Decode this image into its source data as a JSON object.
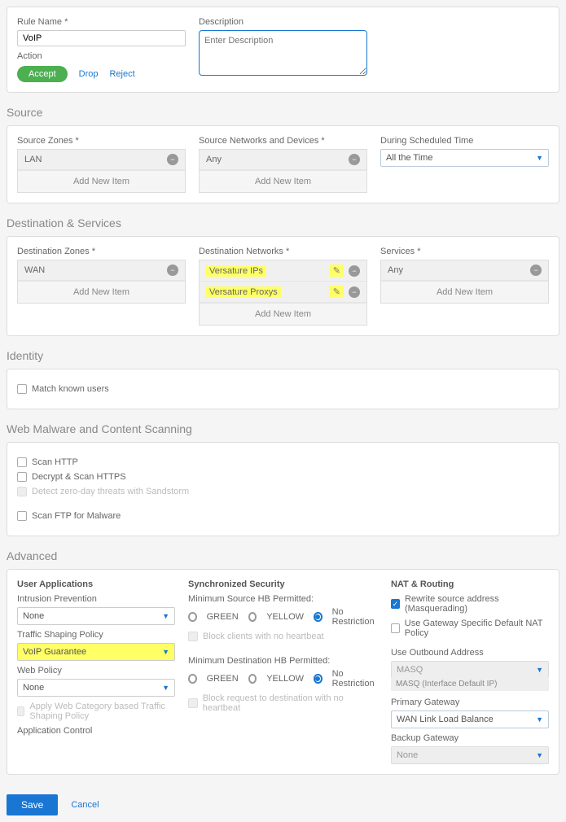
{
  "rule": {
    "name_label": "Rule Name *",
    "name_value": "VoIP",
    "desc_label": "Description",
    "desc_placeholder": "Enter Description",
    "action_label": "Action",
    "accept": "Accept",
    "drop": "Drop",
    "reject": "Reject"
  },
  "source": {
    "title": "Source",
    "zones_label": "Source Zones *",
    "zones_item": "LAN",
    "networks_label": "Source Networks and Devices *",
    "networks_item": "Any",
    "schedule_label": "During Scheduled Time",
    "schedule_value": "All the Time",
    "add_new": "Add New Item"
  },
  "dest": {
    "title": "Destination & Services",
    "zones_label": "Destination Zones *",
    "zones_item": "WAN",
    "networks_label": "Destination Networks *",
    "net1": "Versature IPs",
    "net2": "Versature Proxys",
    "services_label": "Services *",
    "services_item": "Any",
    "add_new": "Add New Item"
  },
  "identity": {
    "title": "Identity",
    "match": "Match known users"
  },
  "scan": {
    "title": "Web Malware and Content Scanning",
    "http": "Scan HTTP",
    "https": "Decrypt & Scan HTTPS",
    "sandstorm": "Detect zero-day threats with Sandstorm",
    "ftp": "Scan FTP for Malware"
  },
  "adv": {
    "title": "Advanced",
    "userapp": "User Applications",
    "ips_label": "Intrusion Prevention",
    "ips_value": "None",
    "traffic_label": "Traffic Shaping Policy",
    "traffic_value": "VoIP Guarantee",
    "webpol_label": "Web Policy",
    "webpol_value": "None",
    "apply_web": "Apply Web Category based Traffic Shaping Policy",
    "appcontrol": "Application Control",
    "sync": "Synchronized Security",
    "min_src": "Minimum Source HB Permitted:",
    "green": "GREEN",
    "yellow": "YELLOW",
    "norest": "No Restriction",
    "block_nohb": "Block clients with no heartbeat",
    "min_dst": "Minimum Destination HB Permitted:",
    "block_dst_nohb": "Block request to destination with no heartbeat",
    "nat": "NAT & Routing",
    "rewrite": "Rewrite source address (Masquerading)",
    "gwnat": "Use Gateway Specific Default NAT Policy",
    "outaddr_label": "Use Outbound Address",
    "outaddr_value": "MASQ",
    "outaddr_sub": "MASQ (Interface Default IP)",
    "pgw_label": "Primary Gateway",
    "pgw_value": "WAN Link Load Balance",
    "bgw_label": "Backup Gateway",
    "bgw_value": "None"
  },
  "footer": {
    "save": "Save",
    "cancel": "Cancel"
  }
}
